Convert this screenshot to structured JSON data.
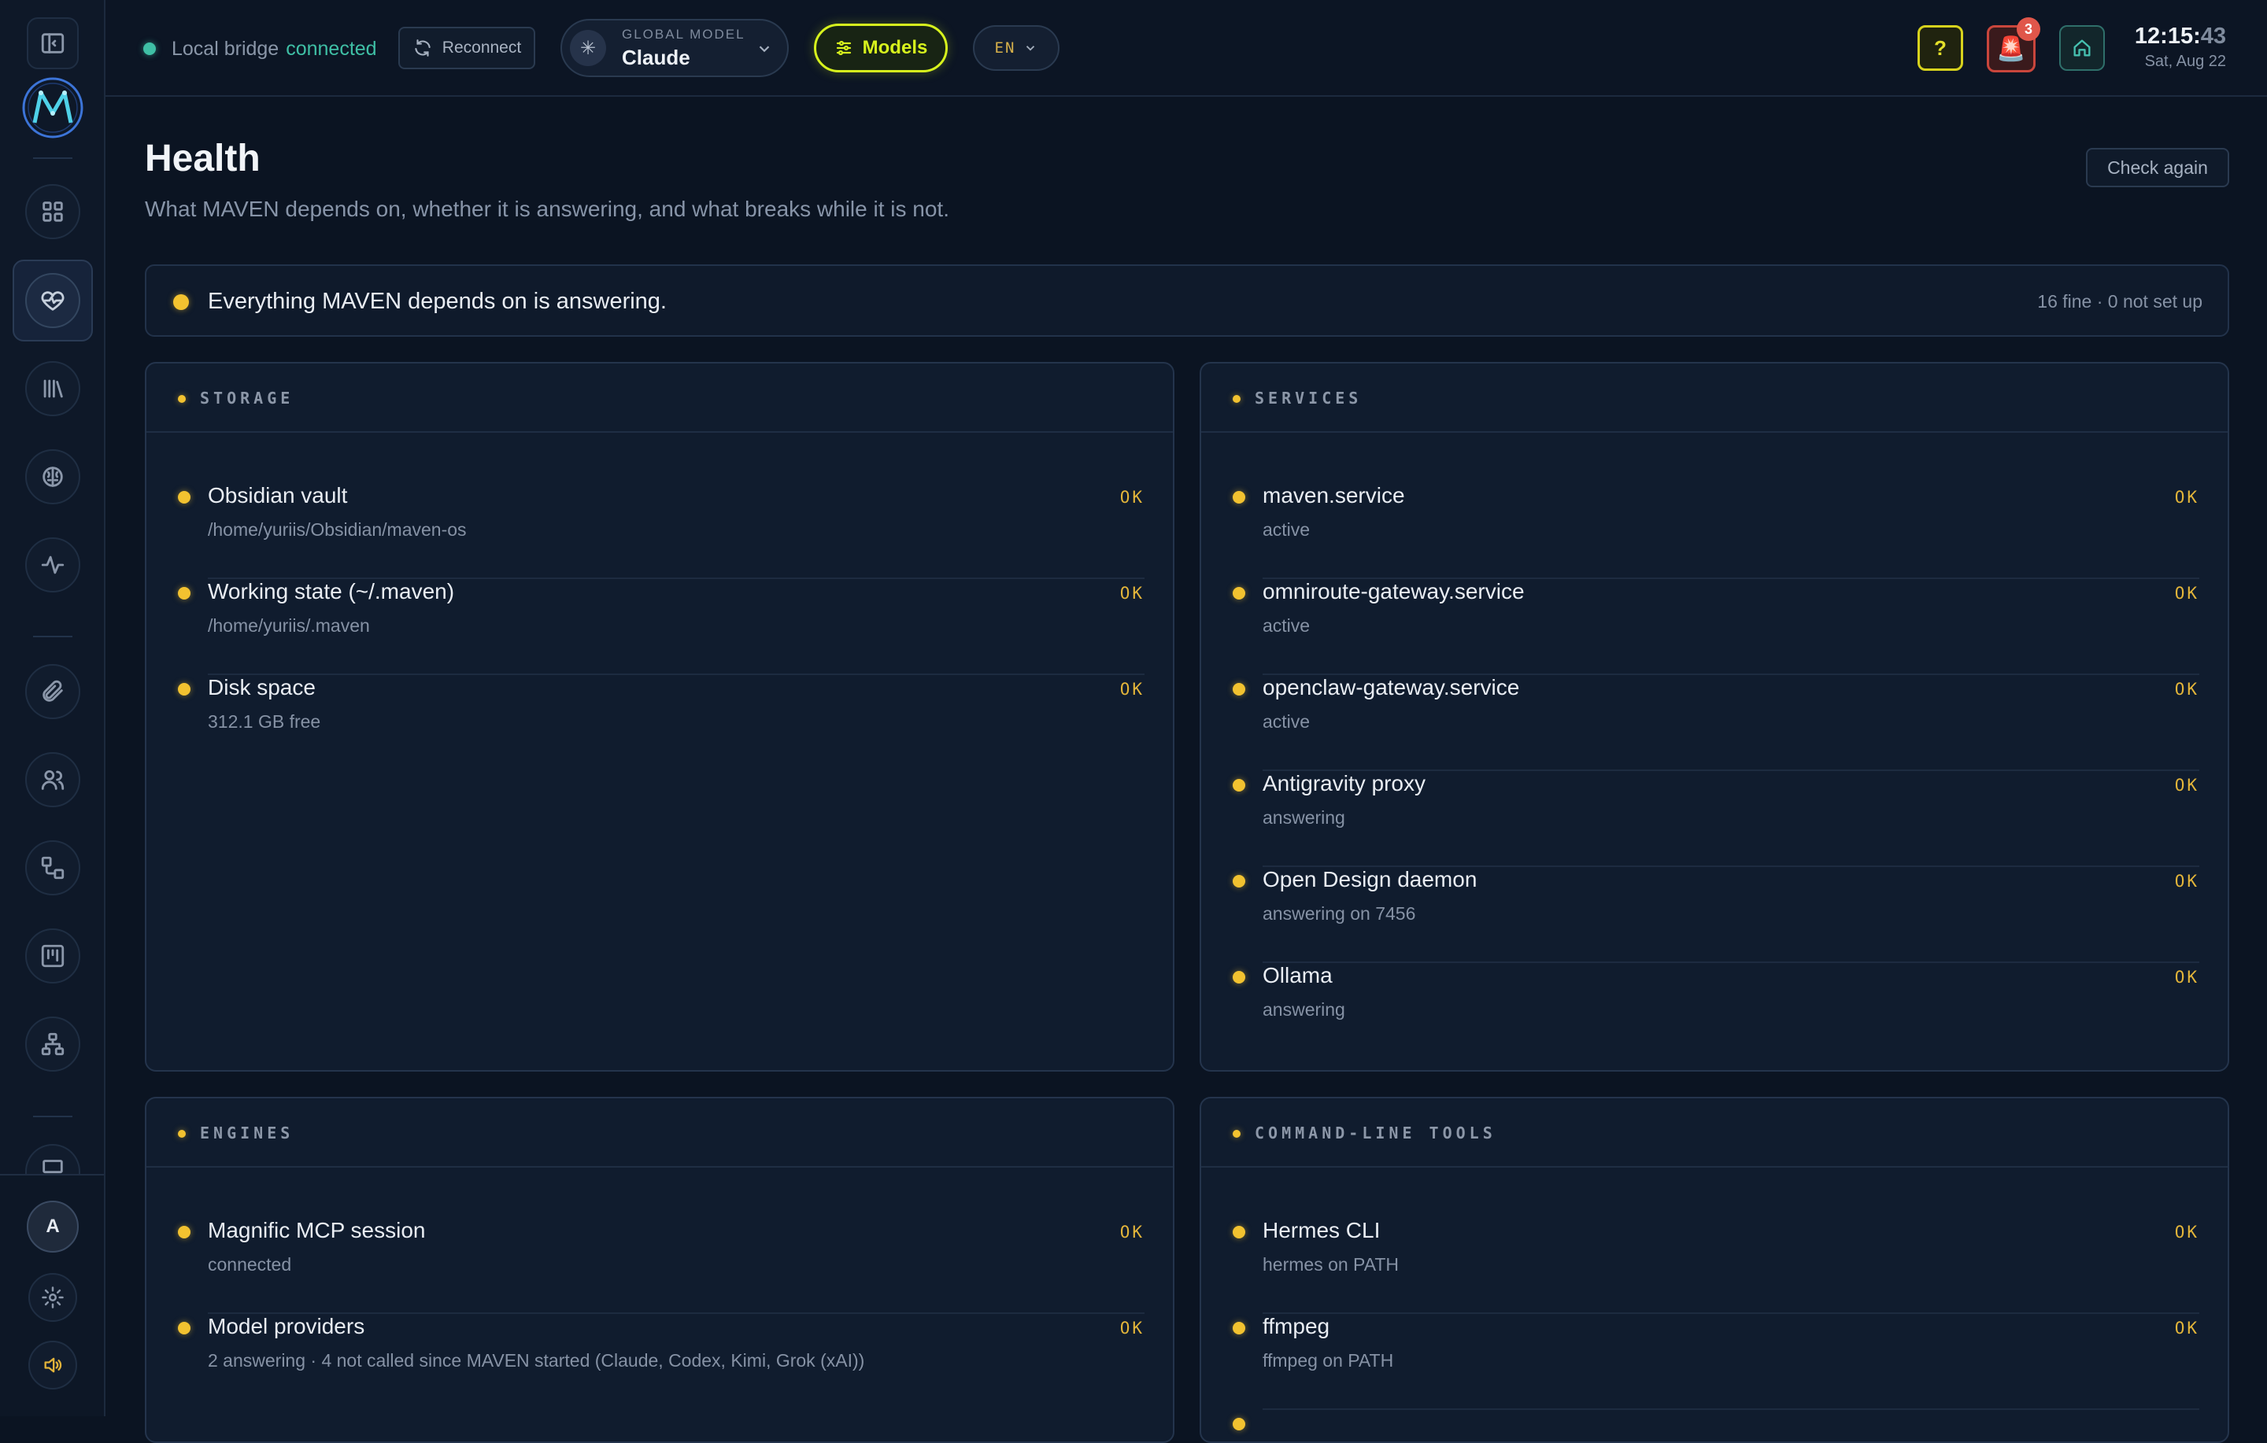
{
  "topbar": {
    "bridge_label": "Local bridge",
    "bridge_status": "connected",
    "reconnect_label": "Reconnect",
    "global_model_caption": "GLOBAL MODEL",
    "global_model_value": "Claude",
    "models_label": "Models",
    "language": "EN",
    "help_label": "?",
    "alerts_count": "3",
    "time_hm": "12:15:",
    "time_s": "43",
    "date": "Sat, Aug 22"
  },
  "sidebar": {
    "avatar_initial": "A",
    "items": [
      "dashboard",
      "health",
      "library",
      "brain",
      "activity",
      "attachments",
      "people",
      "workflows",
      "board",
      "hierarchy",
      "display"
    ]
  },
  "page": {
    "title": "Health",
    "subtitle": "What MAVEN depends on, whether it is answering, and what breaks while it is not.",
    "check_again_label": "Check again"
  },
  "summary": {
    "message": "Everything MAVEN depends on is answering.",
    "counts": "16 fine · 0 not set up"
  },
  "panels": {
    "storage": {
      "title": "STORAGE",
      "rows": [
        {
          "name": "Obsidian vault",
          "detail": "/home/yuriis/Obsidian/maven-os",
          "status": "OK"
        },
        {
          "name": "Working state (~/.maven)",
          "detail": "/home/yuriis/.maven",
          "status": "OK"
        },
        {
          "name": "Disk space",
          "detail": "312.1 GB free",
          "status": "OK"
        }
      ]
    },
    "services": {
      "title": "SERVICES",
      "rows": [
        {
          "name": "maven.service",
          "detail": "active",
          "status": "OK"
        },
        {
          "name": "omniroute-gateway.service",
          "detail": "active",
          "status": "OK"
        },
        {
          "name": "openclaw-gateway.service",
          "detail": "active",
          "status": "OK"
        },
        {
          "name": "Antigravity proxy",
          "detail": "answering",
          "status": "OK"
        },
        {
          "name": "Open Design daemon",
          "detail": "answering on 7456",
          "status": "OK"
        },
        {
          "name": "Ollama",
          "detail": "answering",
          "status": "OK"
        }
      ]
    },
    "engines": {
      "title": "ENGINES",
      "rows": [
        {
          "name": "Magnific MCP session",
          "detail": "connected",
          "status": "OK"
        },
        {
          "name": "Model providers",
          "detail": "2 answering · 4 not called since MAVEN started (Claude, Codex, Kimi, Grok (xAI))",
          "status": "OK"
        }
      ]
    },
    "cli": {
      "title": "COMMAND-LINE TOOLS",
      "rows": [
        {
          "name": "Hermes CLI",
          "detail": "hermes on PATH",
          "status": "OK"
        },
        {
          "name": "ffmpeg",
          "detail": "ffmpeg on PATH",
          "status": "OK"
        }
      ]
    }
  },
  "colors": {
    "ok": "#f2c230",
    "connected": "#3fbfa5",
    "models_accent": "#d7f21d",
    "alert": "#e0564a"
  }
}
